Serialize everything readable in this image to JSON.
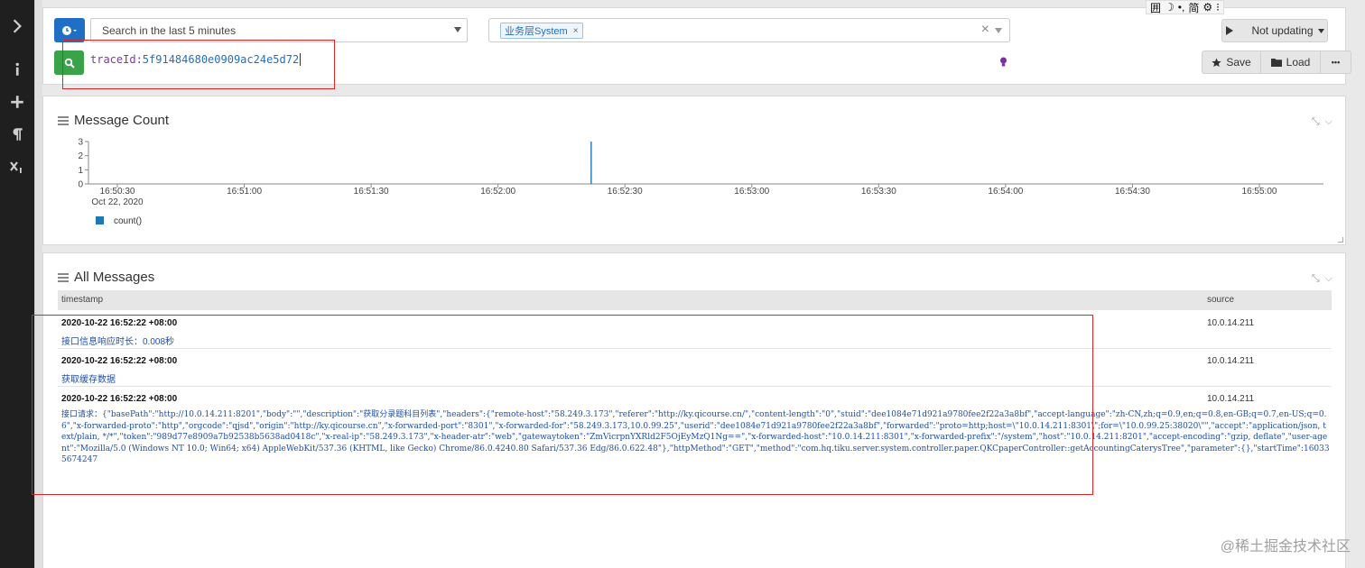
{
  "search": {
    "range_label": "Search in the last 5 minutes",
    "stream_tag": "业务层System",
    "stream_tag_remove": "×",
    "clear_icon": "×",
    "query_key": "traceId:",
    "query_value": "5f91484680e0909ac24e5d72"
  },
  "toolbar": {
    "not_updating": "Not updating",
    "save": "Save",
    "load": "Load",
    "more": "•••"
  },
  "ime": {
    "items": [
      "囲",
      "☽",
      "•,",
      "简",
      "⚙",
      "⁝"
    ]
  },
  "message_count": {
    "title": "Message Count"
  },
  "chart_data": {
    "type": "bar",
    "title": "Message Count",
    "x_ticks": [
      "16:50:30",
      "16:51:00",
      "16:51:30",
      "16:52:00",
      "16:52:30",
      "16:53:00",
      "16:53:30",
      "16:54:00",
      "16:54:30",
      "16:55:00"
    ],
    "x_date_label": "Oct 22, 2020",
    "y_ticks": [
      0,
      1,
      2,
      3
    ],
    "ylim": [
      0,
      3
    ],
    "series": [
      {
        "name": "count()",
        "color": "#1f77b4",
        "points": [
          {
            "x": "16:52:22",
            "y": 3
          }
        ]
      }
    ],
    "legend_placement": "bottom-left"
  },
  "all_messages": {
    "title": "All Messages",
    "columns": {
      "timestamp": "timestamp",
      "source": "source"
    },
    "rows": [
      {
        "timestamp": "2020-10-22 16:52:22 +08:00",
        "source": "10.0.14.211",
        "message": "接口信息响应时长：0.008秒"
      },
      {
        "timestamp": "2020-10-22 16:52:22 +08:00",
        "source": "10.0.14.211",
        "message": "获取缓存数据"
      },
      {
        "timestamp": "2020-10-22 16:52:22 +08:00",
        "source": "10.0.14.211",
        "message": "接口请求：{\"basePath\":\"http://10.0.14.211:8201\",\"body\":\"\",\"description\":\"获取分录题科目列表\",\"headers\":{\"remote-host\":\"58.249.3.173\",\"referer\":\"http://ky.qicourse.cn/\",\"content-length\":\"0\",\"stuid\":\"dee1084e71d921a9780fee2f22a3a8bf\",\"accept-language\":\"zh-CN,zh;q=0.9,en;q=0.8,en-GB;q=0.7,en-US;q=0.6\",\"x-forwarded-proto\":\"http\",\"orgcode\":\"qjsd\",\"origin\":\"http://ky.qicourse.cn\",\"x-forwarded-port\":\"8301\",\"x-forwarded-for\":\"58.249.3.173,10.0.99.25\",\"userid\":\"dee1084e71d921a9780fee2f22a3a8bf\",\"forwarded\":\"proto=http;host=\\\"10.0.14.211:8301\\\";for=\\\"10.0.99.25:38020\\\"\",\"accept\":\"application/json, text/plain, */*\",\"token\":\"989d77e8909a7b92538b5638ad0418c\",\"x-real-ip\":\"58.249.3.173\",\"x-header-atr\":\"web\",\"gatewaytoken\":\"ZmVicrpnYXRld2F5OjEyMzQ1Ng==\",\"x-forwarded-host\":\"10.0.14.211:8301\",\"x-forwarded-prefix\":\"/system\",\"host\":\"10.0.14.211:8201\",\"accept-encoding\":\"gzip, deflate\",\"user-agent\":\"Mozilla/5.0 (Windows NT 10.0; Win64; x64) AppleWebKit/537.36 (KHTML, like Gecko) Chrome/86.0.4240.80 Safari/537.36 Edg/86.0.622.48\"},\"httpMethod\":\"GET\",\"method\":\"com.hq.tiku.server.system.controller.paper.QKCpaperController::getAccountingCaterysTree\",\"parameter\":{},\"startTime\":160335674247"
      }
    ]
  },
  "watermark": "@稀土掘金技术社区",
  "colors": {
    "primary": "#1f6fc5",
    "search_green": "#3aa34a",
    "annotation_red": "#d9262b",
    "sidebar": "#1f1f1f"
  }
}
